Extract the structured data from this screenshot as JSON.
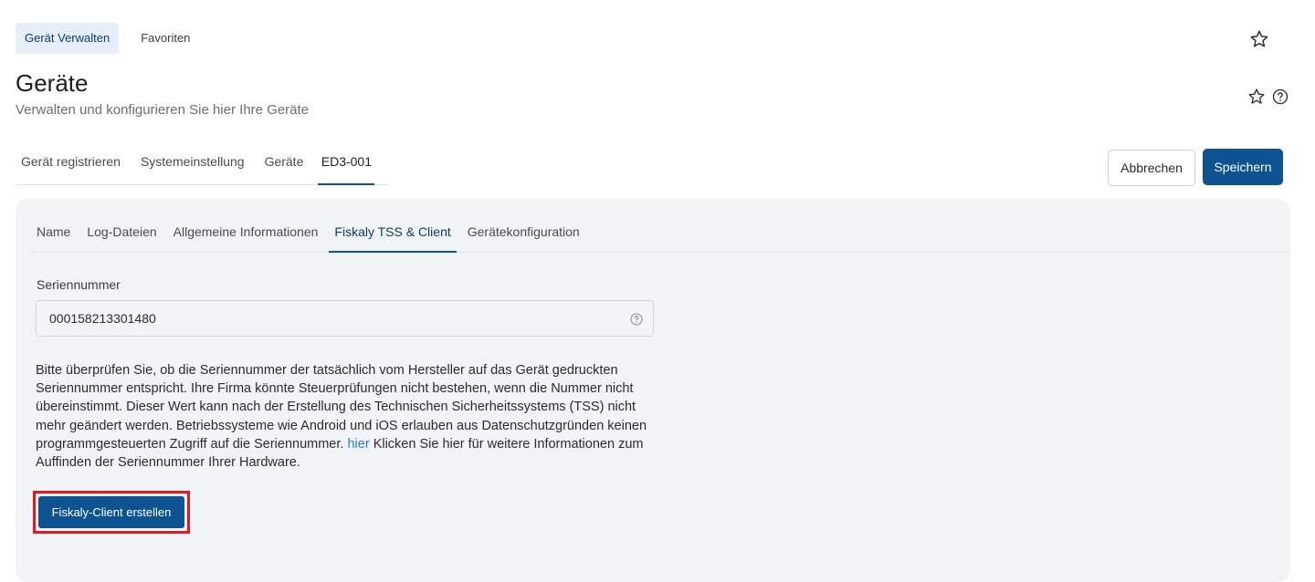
{
  "top_tabs": [
    {
      "label": "Gerät Verwalten",
      "active": true
    },
    {
      "label": "Favoriten",
      "active": false
    }
  ],
  "header": {
    "title": "Geräte",
    "subtitle": "Verwalten und konfigurieren Sie hier Ihre Geräte"
  },
  "breadcrumb_tabs": [
    {
      "label": "Gerät registrieren"
    },
    {
      "label": "Systemeinstellung"
    },
    {
      "label": "Geräte"
    },
    {
      "label": "ED3-001",
      "active": true
    }
  ],
  "actions": {
    "cancel_label": "Abbrechen",
    "save_label": "Speichern"
  },
  "detail_tabs": [
    {
      "label": "Name"
    },
    {
      "label": "Log-Dateien"
    },
    {
      "label": "Allgemeine Informationen"
    },
    {
      "label": "Fiskaly TSS & Client",
      "active": true
    },
    {
      "label": "Gerätekonfiguration"
    }
  ],
  "serial": {
    "label": "Seriennummer",
    "value": "000158213301480"
  },
  "info": {
    "text_before_link": "Bitte überprüfen Sie, ob die Seriennummer der tatsächlich vom Hersteller auf das Gerät gedruckten Seriennummer entspricht. Ihre Firma könnte Steuerprüfungen nicht bestehen, wenn die Nummer nicht übereinstimmt. Dieser Wert kann nach der Erstellung des Technischen Sicherheitssystems (TSS) nicht mehr geändert werden. Betriebssysteme wie Android und iOS erlauben aus Datenschutzgründen keinen programmgesteuerten Zugriff auf die Seriennummer.",
    "link_text": "hier",
    "text_after_link": "Klicken Sie hier für weitere Informationen zum Auffinden der Seriennummer Ihrer Hardware."
  },
  "create_button_label": "Fiskaly-Client erstellen",
  "colors": {
    "primary": "#0d5291",
    "link": "#2a7ad2",
    "highlight": "#e01a22",
    "panel_bg": "#f1f4f7"
  }
}
